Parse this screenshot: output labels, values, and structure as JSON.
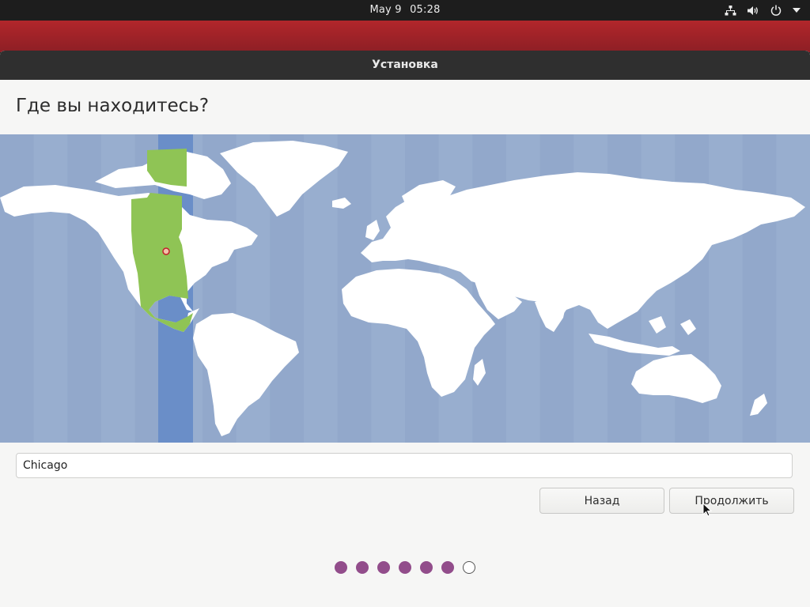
{
  "topbar": {
    "date": "May 9",
    "time": "05:28",
    "tray_icons": [
      "network-icon",
      "volume-icon",
      "power-icon",
      "menu-arrow-icon"
    ]
  },
  "window": {
    "title": "Установка"
  },
  "page": {
    "heading": "Где вы находитесь?"
  },
  "map": {
    "selected_timezone_color": "#8fc455",
    "highlight_band_color": "#6a8ec8",
    "ocean_color": "#93a9cc",
    "land_color": "#ffffff",
    "marker": "Chicago"
  },
  "location_field": {
    "value": "Chicago"
  },
  "buttons": {
    "back": "Назад",
    "continue": "Продолжить"
  },
  "progress": {
    "total_steps": 7,
    "completed_steps": 6
  },
  "colors": {
    "accent_purple": "#924d8b",
    "desktop_red": "#a8242a"
  }
}
